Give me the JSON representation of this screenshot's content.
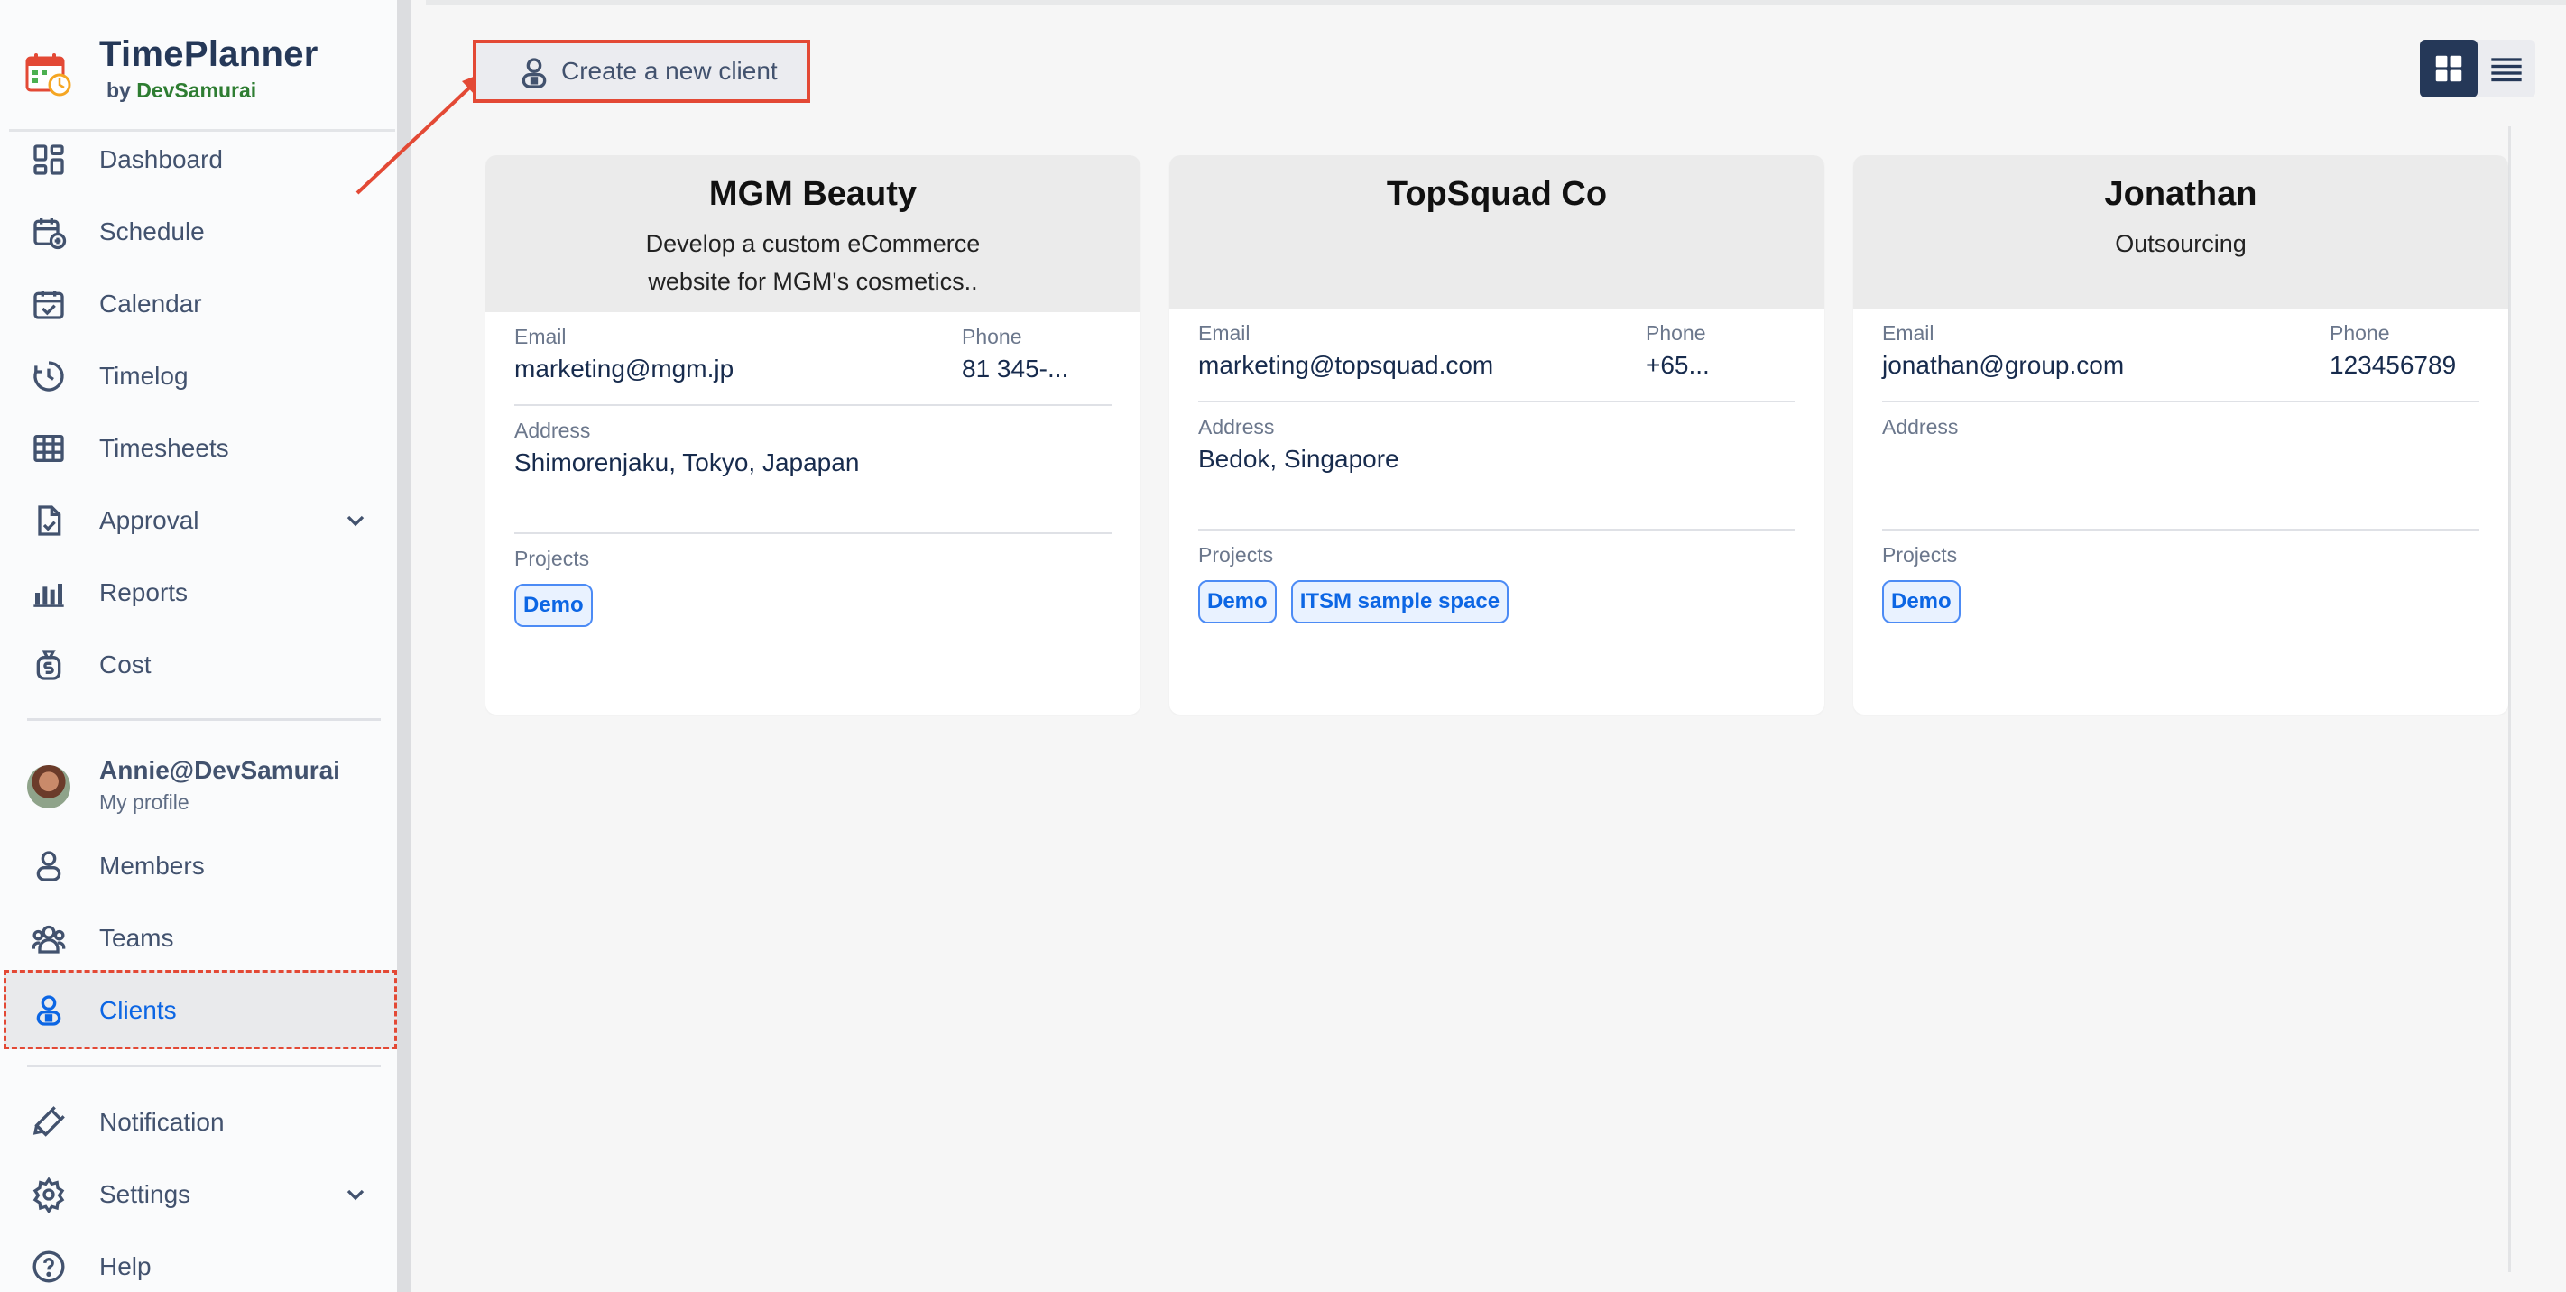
{
  "brand": {
    "name": "TimePlanner",
    "by_prefix": "by",
    "by_company": "DevSamurai"
  },
  "nav": {
    "dashboard": "Dashboard",
    "schedule": "Schedule",
    "calendar": "Calendar",
    "timelog": "Timelog",
    "timesheets": "Timesheets",
    "approval": "Approval",
    "reports": "Reports",
    "cost": "Cost",
    "members": "Members",
    "teams": "Teams",
    "clients": "Clients",
    "notification": "Notification",
    "settings": "Settings",
    "help": "Help"
  },
  "profile": {
    "name": "Annie@DevSamurai",
    "subtitle": "My profile"
  },
  "toolbar": {
    "create_label": "Create a new client"
  },
  "labels": {
    "email": "Email",
    "phone": "Phone",
    "address": "Address",
    "projects": "Projects"
  },
  "clients": [
    {
      "name": "MGM Beauty",
      "description": "Develop a custom eCommerce website for MGM's cosmetics..",
      "email": "marketing@mgm.jp",
      "phone": "81 345-...",
      "address": "Shimorenjaku, Tokyo, Japapan",
      "projects": [
        "Demo"
      ]
    },
    {
      "name": "TopSquad Co",
      "description": "",
      "email": "marketing@topsquad.com",
      "phone": "+65...",
      "address": "Bedok, Singapore",
      "projects": [
        "Demo",
        "ITSM sample space"
      ]
    },
    {
      "name": "Jonathan",
      "description": "Outsourcing",
      "email": "jonathan@group.com",
      "phone": "123456789",
      "address": "",
      "projects": [
        "Demo"
      ]
    }
  ],
  "colors": {
    "accent": "#0c66e4",
    "highlight": "#e34935",
    "toggle_active": "#253858"
  }
}
